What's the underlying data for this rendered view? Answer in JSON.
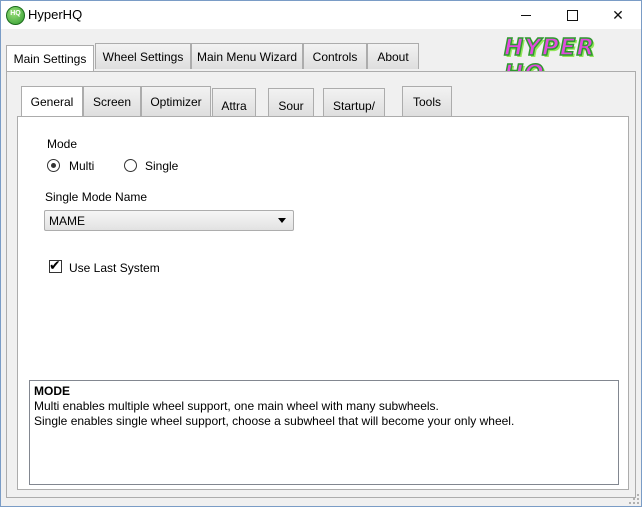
{
  "window": {
    "title": "HyperHQ",
    "app_icon_text": "HQ",
    "minimize": "minimize",
    "maximize": "maximize",
    "close": "✕"
  },
  "logo": {
    "text": "HYPER HQ"
  },
  "main_tabs": [
    {
      "label": "Main Settings",
      "active": true
    },
    {
      "label": "Wheel Settings",
      "active": false
    },
    {
      "label": "Main Menu Wizard",
      "active": false
    },
    {
      "label": "Controls",
      "active": false
    },
    {
      "label": "About",
      "active": false
    }
  ],
  "sub_tabs": [
    {
      "label": "General",
      "active": true
    },
    {
      "label": "Screen",
      "active": false
    },
    {
      "label": "Optimizer",
      "active": false
    },
    {
      "label": "Attra",
      "active": false
    },
    {
      "label": "Sour",
      "active": false
    },
    {
      "label": "Startup/",
      "active": false
    },
    {
      "label": "Tools",
      "active": false
    }
  ],
  "general": {
    "mode_label": "Mode",
    "mode_options": [
      {
        "label": "Multi",
        "selected": true
      },
      {
        "label": "Single",
        "selected": false
      }
    ],
    "single_mode_name_label": "Single Mode Name",
    "single_mode_name_value": "MAME",
    "use_last_system_label": "Use Last System",
    "use_last_system_checked": true
  },
  "info": {
    "title": "MODE",
    "line1": "Multi enables multiple wheel support, one main wheel with many subwheels.",
    "line2": "Single enables single wheel support, choose a subwheel that will become your only wheel."
  }
}
